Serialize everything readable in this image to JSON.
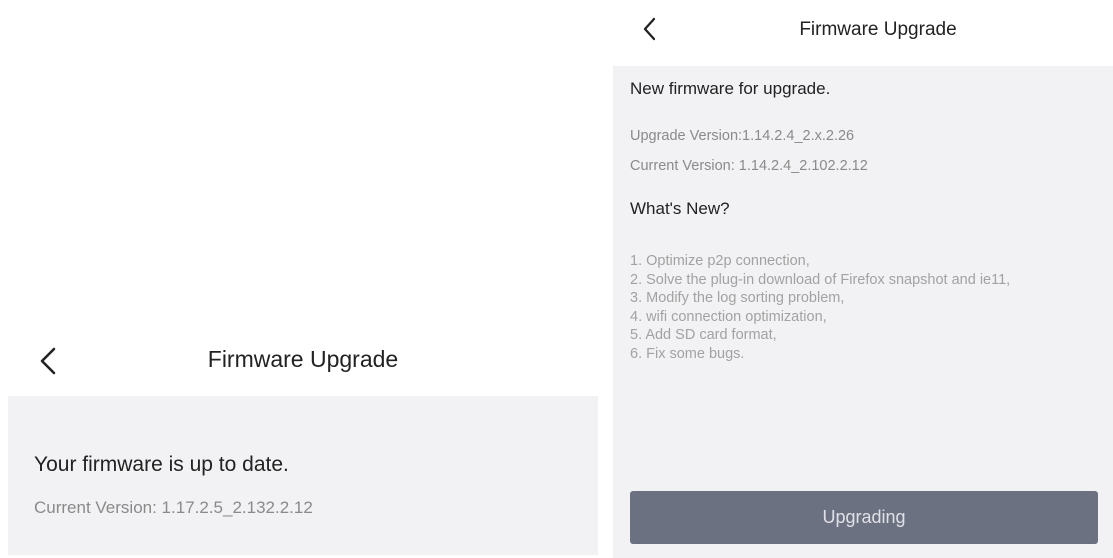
{
  "left_screen": {
    "title": "Firmware Upgrade",
    "status": "Your firmware is up to date.",
    "current_version": "Current Version: 1.17.2.5_2.132.2.12"
  },
  "right_screen": {
    "title": "Firmware Upgrade",
    "heading": "New firmware for upgrade.",
    "upgrade_version": "Upgrade Version:1.14.2.4_2.x.2.26",
    "current_version": "Current Version: 1.14.2.4_2.102.2.12",
    "whats_new_title": "What's New?",
    "notes": [
      "1. Optimize p2p connection,",
      "2. Solve the plug-in download of Firefox snapshot and ie11,",
      "3. Modify the log sorting problem,",
      "4. wifi connection optimization,",
      "5. Add SD card format,",
      "6. Fix some bugs."
    ],
    "button_label": "Upgrading"
  },
  "icons": {
    "back": "chevron-left-icon"
  },
  "colors": {
    "panel_background": "#f2f2f4",
    "header_background": "#ffffff",
    "button_background": "#6c7182",
    "button_text": "#dfe1e6",
    "primary_text": "#222222",
    "secondary_text": "#8a8a8a"
  }
}
